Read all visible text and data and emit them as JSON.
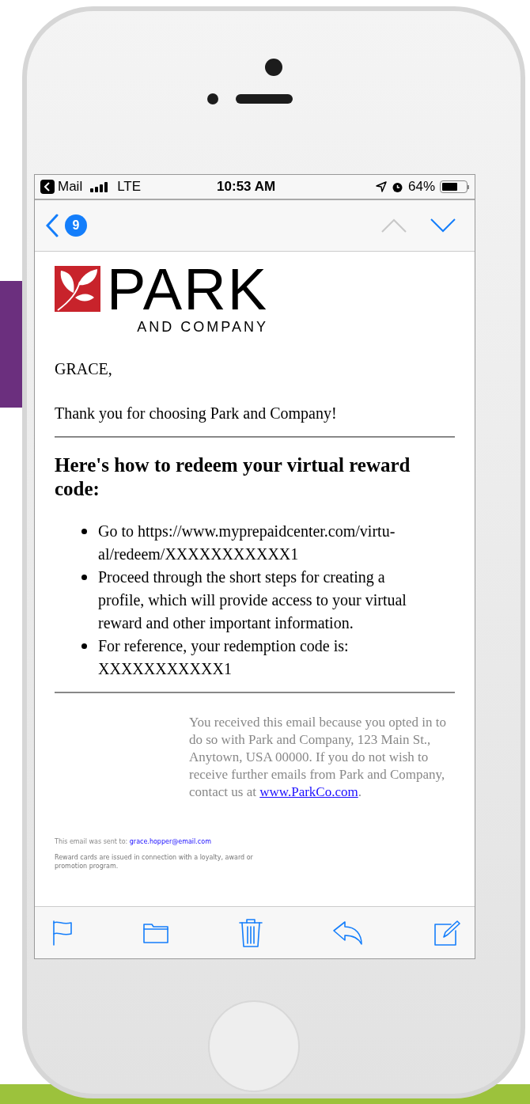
{
  "status_bar": {
    "back_app": "Mail",
    "network": "LTE",
    "time": "10:53 AM",
    "battery": {
      "reading": "64%",
      "level": 0.64
    }
  },
  "nav_bar": {
    "unread_count": "9",
    "previous_disabled": true,
    "next_disabled": false
  },
  "email": {
    "logo": {
      "name": "PARK",
      "tagline": "AND COMPANY"
    },
    "greeting": "GRACE,",
    "intro": "Thank you for choosing Park and Company!",
    "heading": "Here's how to redeem your virtual reward code:",
    "steps": [
      "Go to https://www.myprepaidcenter.com/virtu-al/redeem/XXXXXXXXXXX1",
      "Proceed through the short steps for creating a profile, which will provide access to your virtual reward and other important information.",
      "For reference, your redemption code is: XXXXXXXXXXX1"
    ],
    "notice": {
      "text": "You received this email because you opted in to do so with Park and Company, 123 Main St., Anytown, USA 00000. If you do not wish to receive further emails from Park and Company, contact us at ",
      "link": "www.ParkCo.com",
      "suffix": "."
    },
    "sent_to": {
      "label": "This email was sent to: ",
      "address": "grace.hopper@email.com"
    },
    "disclaimer": "Reward cards are issued in connection with a loyalty, award or promotion program."
  },
  "toolbar": [
    {
      "kind": "flag"
    },
    {
      "kind": "folder"
    },
    {
      "kind": "trash"
    },
    {
      "kind": "reply"
    },
    {
      "kind": "compose"
    }
  ]
}
